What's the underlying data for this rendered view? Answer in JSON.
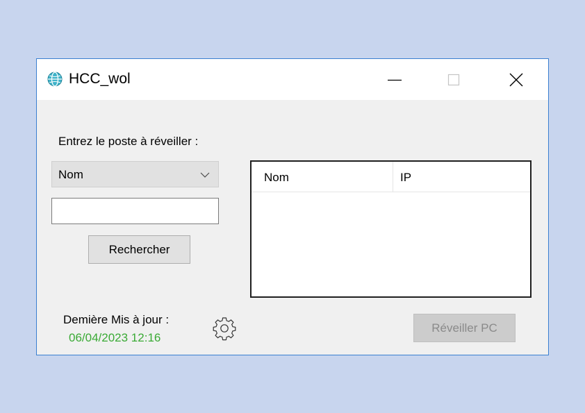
{
  "window": {
    "title": "HCC_wol",
    "icon": "network-globe-icon"
  },
  "form": {
    "prompt_label": "Entrez le poste à réveiller :",
    "filter_select": {
      "selected": "Nom"
    },
    "search_input": {
      "value": ""
    },
    "search_button_label": "Rechercher"
  },
  "results": {
    "columns": [
      "Nom",
      "IP"
    ],
    "rows": []
  },
  "footer": {
    "last_update_label": "Demière Mis à jour :",
    "last_update_value": "06/04/2023 12:16",
    "last_update_color": "#3aaa35",
    "settings_icon": "gear-icon",
    "wake_button_label": "Réveiller PC",
    "wake_button_enabled": false
  },
  "colors": {
    "desktop_bg": "#c8d5ee",
    "window_border": "#3a7fd0",
    "window_bg": "#f0f0f0"
  }
}
